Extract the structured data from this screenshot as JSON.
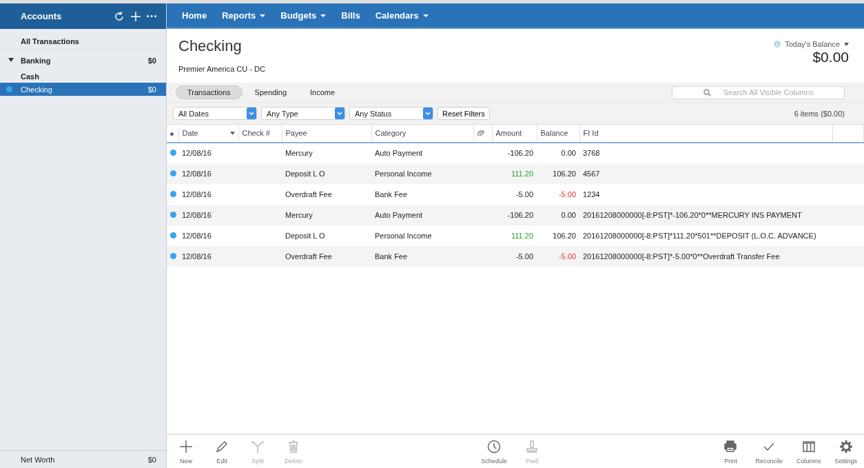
{
  "sidebar": {
    "title": "Accounts",
    "footer": {
      "label": "Net Worth",
      "value": "$0"
    },
    "items": [
      {
        "kind": "link",
        "label": "All Transactions",
        "selected": false
      },
      {
        "kind": "group",
        "label": "Banking",
        "value": "$0",
        "expanded": true,
        "children": [
          {
            "label": "Cash",
            "selected": false
          },
          {
            "label": "Checking",
            "value": "$0",
            "selected": true
          }
        ]
      }
    ]
  },
  "nav": [
    {
      "label": "Home",
      "menu": false
    },
    {
      "label": "Reports",
      "menu": true
    },
    {
      "label": "Budgets",
      "menu": true
    },
    {
      "label": "Bills",
      "menu": false
    },
    {
      "label": "Calendars",
      "menu": true
    }
  ],
  "account": {
    "title": "Checking",
    "subtitle": "Premier America CU - DC",
    "balance_label": "Today's Balance",
    "balance": "$0.00"
  },
  "tabs": [
    {
      "label": "Transactions",
      "selected": true
    },
    {
      "label": "Spending",
      "selected": false
    },
    {
      "label": "Income",
      "selected": false
    }
  ],
  "search": {
    "placeholder": "Search All Visible Columns"
  },
  "filters": [
    {
      "value": "All Dates"
    },
    {
      "value": "Any Type"
    },
    {
      "value": "Any Status"
    }
  ],
  "reset_button": "Reset Filters",
  "item_count": "6 items ($0.00)",
  "table": {
    "columns": [
      "Date",
      "Check #",
      "Payee",
      "Category",
      "Amount",
      "Balance",
      "FI Id"
    ],
    "rows": [
      {
        "marked": true,
        "date": "12/08/16",
        "payee": "Mercury",
        "category": "Auto Payment",
        "amount": "-106.20",
        "amount_income": false,
        "balance": "0.00",
        "balance_negative": false,
        "fi_id": "3768"
      },
      {
        "marked": true,
        "date": "12/08/16",
        "payee": "Deposit L O",
        "category": "Personal Income",
        "amount": "111.20",
        "amount_income": true,
        "balance": "106.20",
        "balance_negative": false,
        "fi_id": "4567"
      },
      {
        "marked": true,
        "date": "12/08/16",
        "payee": "Overdraft Fee",
        "category": "Bank Fee",
        "amount": "-5.00",
        "amount_income": false,
        "balance": "-5.00",
        "balance_negative": true,
        "fi_id": "1234"
      },
      {
        "marked": true,
        "date": "12/08/16",
        "payee": "Mercury",
        "category": "Auto Payment",
        "amount": "-106.20",
        "amount_income": false,
        "balance": "0.00",
        "balance_negative": false,
        "fi_id": "20161208000000[-8:PST]*-106.20*0**MERCURY INS PAYMENT"
      },
      {
        "marked": true,
        "date": "12/08/16",
        "payee": "Deposit L O",
        "category": "Personal Income",
        "amount": "111.20",
        "amount_income": true,
        "balance": "106.20",
        "balance_negative": false,
        "fi_id": "20161208000000[-8:PST]*111.20*501**DEPOSIT (L.O.C. ADVANCE)"
      },
      {
        "marked": true,
        "date": "12/08/16",
        "payee": "Overdraft Fee",
        "category": "Bank Fee",
        "amount": "-5.00",
        "amount_income": false,
        "balance": "-5.00",
        "balance_negative": true,
        "fi_id": "20161208000000[-8:PST]*-5.00*0**Overdraft Transfer Fee"
      }
    ]
  },
  "toolbar": {
    "left": [
      {
        "kind": "plus",
        "label": "New",
        "disabled": false
      },
      {
        "kind": "pencil",
        "label": "Edit",
        "disabled": false
      },
      {
        "kind": "split",
        "label": "Split",
        "disabled": true
      },
      {
        "kind": "trash",
        "label": "Delete",
        "disabled": true
      }
    ],
    "center": [
      {
        "kind": "clock",
        "label": "Schedule",
        "disabled": false
      },
      {
        "kind": "stamp",
        "label": "Paid",
        "disabled": true
      }
    ],
    "right": [
      {
        "kind": "printer",
        "label": "Print",
        "disabled": false
      },
      {
        "kind": "check",
        "label": "Reconcile",
        "disabled": false
      },
      {
        "kind": "columns",
        "label": "Columns",
        "disabled": false
      },
      {
        "kind": "gear",
        "label": "Settings",
        "disabled": false
      }
    ]
  }
}
